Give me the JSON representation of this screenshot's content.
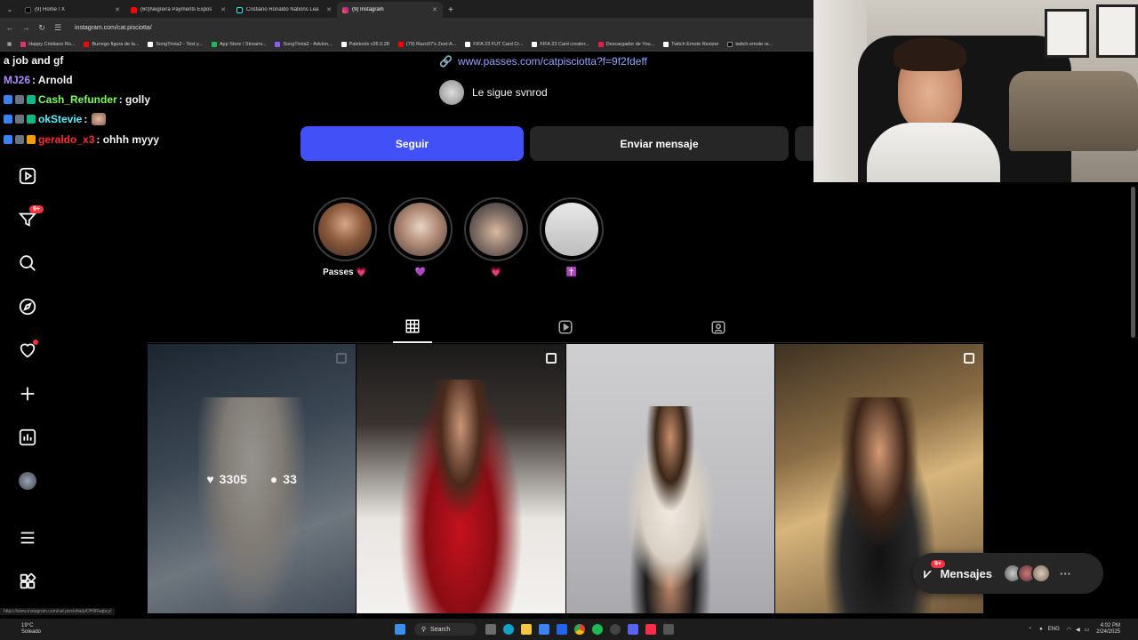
{
  "browser": {
    "tabs": [
      {
        "label": "(9) Home / X",
        "color": "#000000",
        "active": false
      },
      {
        "label": "(60)Negreira Payments Expos",
        "color": "#ff0000",
        "active": false
      },
      {
        "label": "Cristiano Ronaldo Nations Lea",
        "color": "#1a1a1a",
        "active": false
      },
      {
        "label": "(9) Instagram",
        "color": "#e1306c",
        "active": true
      }
    ],
    "url": "instagram.com/cat.pisciotta/",
    "bookmarks": [
      {
        "label": "Happy Cristiano Ro...",
        "color": "#e1306c"
      },
      {
        "label": "Burrego figura de la...",
        "color": "#ff0000"
      },
      {
        "label": "SongTrivia2 - Test y...",
        "color": "#ffffff"
      },
      {
        "label": "App Store / Streami...",
        "color": "#1db954"
      },
      {
        "label": "SongTrivia2 - Advinn...",
        "color": "#8b5cf6"
      },
      {
        "label": "Paletools v26.0.28",
        "color": "#ffffff"
      },
      {
        "label": "(79) Razo97's Zest-A...",
        "color": "#ff0000"
      },
      {
        "label": "FIFA 23 FUT Card Cr...",
        "color": "#ffffff"
      },
      {
        "label": "FIFA 23 Card creator...",
        "color": "#ffffff"
      },
      {
        "label": "Descargador de You...",
        "color": "#e11d48"
      },
      {
        "label": "Twitch Emote Resizer",
        "color": "#ffffff"
      },
      {
        "label": "twitch emote re...",
        "color": "#000000"
      }
    ],
    "status_url": "https://www.instagram.com/cat.pisciotta/p/DH9Ruqbcy/"
  },
  "chat": {
    "lines": [
      {
        "user": "",
        "user_color": "#ffffff",
        "message": "a job and gf"
      },
      {
        "user": "MJ26",
        "user_color": "#b18cff",
        "message": ": Arnold"
      },
      {
        "user": "Cash_Refunder",
        "user_color": "#7cff5a",
        "message": ": golly"
      },
      {
        "user": "okStevie",
        "user_color": "#5af0ff",
        "message": ":"
      },
      {
        "user": "geraldo_x3",
        "user_color": "#ff2d2d",
        "message": ": ohhh myyy"
      }
    ]
  },
  "profile": {
    "link": "www.passes.com/catpisciotta?f=9f2fdeff",
    "followed_by": "Le sigue svnrod",
    "follow_label": "Seguir",
    "message_label": "Enviar mensaje",
    "highlights": [
      {
        "label": "Passes",
        "emoji": "💗"
      },
      {
        "label": "",
        "emoji": "💜"
      },
      {
        "label": "",
        "emoji": "💗"
      },
      {
        "label": "",
        "emoji": "✝️"
      }
    ],
    "active_tab": "posts",
    "posts": [
      {
        "likes": "3305",
        "comments": "33",
        "hovered": true
      },
      {
        "likes": "",
        "comments": "",
        "hovered": false
      },
      {
        "likes": "",
        "comments": "",
        "hovered": false
      },
      {
        "likes": "",
        "comments": "",
        "hovered": false
      }
    ]
  },
  "nav": {
    "notifications_badge": "9+"
  },
  "messages": {
    "label": "Mensajes",
    "badge": "9+"
  },
  "taskbar": {
    "weather_temp": "19°C",
    "weather_desc": "Soleado",
    "search_label": "Search",
    "lang": "ENG",
    "time": "4:02 PM",
    "date": "2/24/2025"
  },
  "colors": {
    "follow_button": "#4150f7",
    "link": "#93a5ff",
    "badge": "#ff3040"
  }
}
